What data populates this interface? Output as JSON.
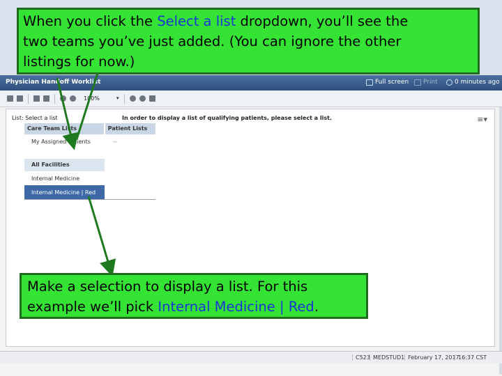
{
  "callouts": {
    "top": {
      "line1_pre": "When you click the ",
      "line1_hl": "Select a list",
      "line1_post": " dropdown, you’ll see the",
      "line2": "two teams you’ve just added.  (You can ignore the other",
      "line3": "listings for now.)"
    },
    "bottom": {
      "line1": "Make a selection to display a list.  For this",
      "line2_pre": "example we’ll pick ",
      "line2_hl": "Internal Medicine | Red",
      "line2_post": "."
    }
  },
  "window": {
    "title": "Physician Handoff Worklist",
    "full_screen_label": "Full screen",
    "print_label": "Print",
    "refresh_label": "0 minutes ago"
  },
  "toolbar": {
    "zoom": "100%"
  },
  "panel": {
    "list_label": "List: Select a list",
    "prompt": "In order to display a list of qualifying patients, please select a list.",
    "menu_icon_glyph": "≡▾"
  },
  "dropdown": {
    "care_team_header": "Care Team Lists",
    "patient_header": "Patient Lists",
    "my_assigned": "My Assigned Patients",
    "patient_placeholder": "--",
    "group_header": "All Facilities",
    "items": [
      "Internal Medicine",
      "Internal Medicine | Red"
    ],
    "selected_index": 1
  },
  "status": {
    "code": "C523",
    "user": "MEDSTUD1",
    "date": "February 17, 2017",
    "time": "16:37 CST"
  },
  "colors": {
    "callout_bg": "#34e334",
    "callout_border": "#1f6b1f",
    "highlight_text": "#1a36d6",
    "selected_bg": "#3d6aa7"
  }
}
